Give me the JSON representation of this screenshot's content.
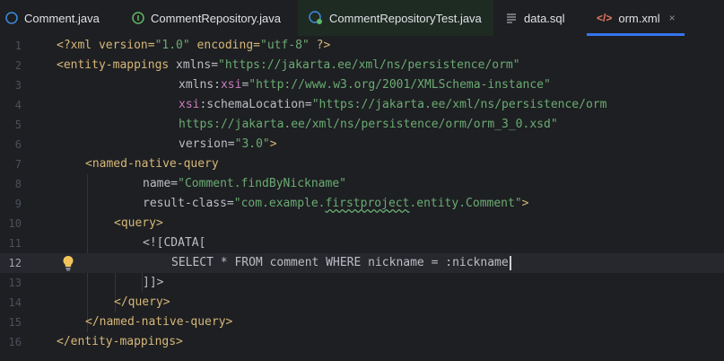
{
  "tabs": [
    {
      "label": "Comment.java",
      "icon": "java-class-icon"
    },
    {
      "label": "CommentRepository.java",
      "icon": "interface-icon"
    },
    {
      "label": "CommentRepositoryTest.java",
      "icon": "test-class-icon"
    },
    {
      "label": "data.sql",
      "icon": "sql-file-icon"
    },
    {
      "label": "orm.xml",
      "icon": "xml-file-icon",
      "active": true,
      "close": "×"
    }
  ],
  "lines": [
    {
      "n": "1"
    },
    {
      "n": "2"
    },
    {
      "n": "3"
    },
    {
      "n": "4"
    },
    {
      "n": "5"
    },
    {
      "n": "6"
    },
    {
      "n": "7"
    },
    {
      "n": "8"
    },
    {
      "n": "9"
    },
    {
      "n": "10"
    },
    {
      "n": "11"
    },
    {
      "n": "12"
    },
    {
      "n": "13"
    },
    {
      "n": "14"
    },
    {
      "n": "15"
    },
    {
      "n": "16"
    }
  ],
  "code": {
    "l1": {
      "a": "<?xml version=",
      "b": "\"1.0\"",
      "c": " encoding=",
      "d": "\"utf-8\"",
      "e": " ?>"
    },
    "l2": {
      "a": "<entity-mappings",
      "b": " xmlns=",
      "c": "\"https://jakarta.ee/xml/ns/persistence/orm\""
    },
    "l3": {
      "a": "xmlns:",
      "b": "xsi",
      "c": "=",
      "d": "\"http://www.w3.org/2001/XMLSchema-instance\""
    },
    "l4": {
      "a": "xsi",
      "b": ":schemaLocation=",
      "c": "\"https://jakarta.ee/xml/ns/persistence/orm"
    },
    "l5": {
      "a": "https://jakarta.ee/xml/ns/persistence/orm/orm_3_0.xsd\""
    },
    "l6": {
      "a": "version=",
      "b": "\"3.0\"",
      "c": ">"
    },
    "l7": {
      "a": "<named-native-query"
    },
    "l8": {
      "a": "name=",
      "b": "\"Comment.findByNickname\""
    },
    "l9": {
      "a": "result-class=",
      "b": "\"com.example.",
      "c": "firstproject",
      "d": ".entity.Comment\"",
      "e": ">"
    },
    "l10": {
      "a": "<query>"
    },
    "l11": {
      "a": "<![CDATA["
    },
    "l12": {
      "a": "SELECT * FROM comment WHERE nickname = :nickname"
    },
    "l13": {
      "a": "]]>"
    },
    "l14": {
      "a": "</query>"
    },
    "l15": {
      "a": "</named-native-query>"
    },
    "l16": {
      "a": "</entity-mappings>"
    }
  },
  "colors": {
    "accent": "#3574f0",
    "tag": "#d5b778",
    "string": "#6aab73",
    "namespace": "#c77dbb"
  }
}
